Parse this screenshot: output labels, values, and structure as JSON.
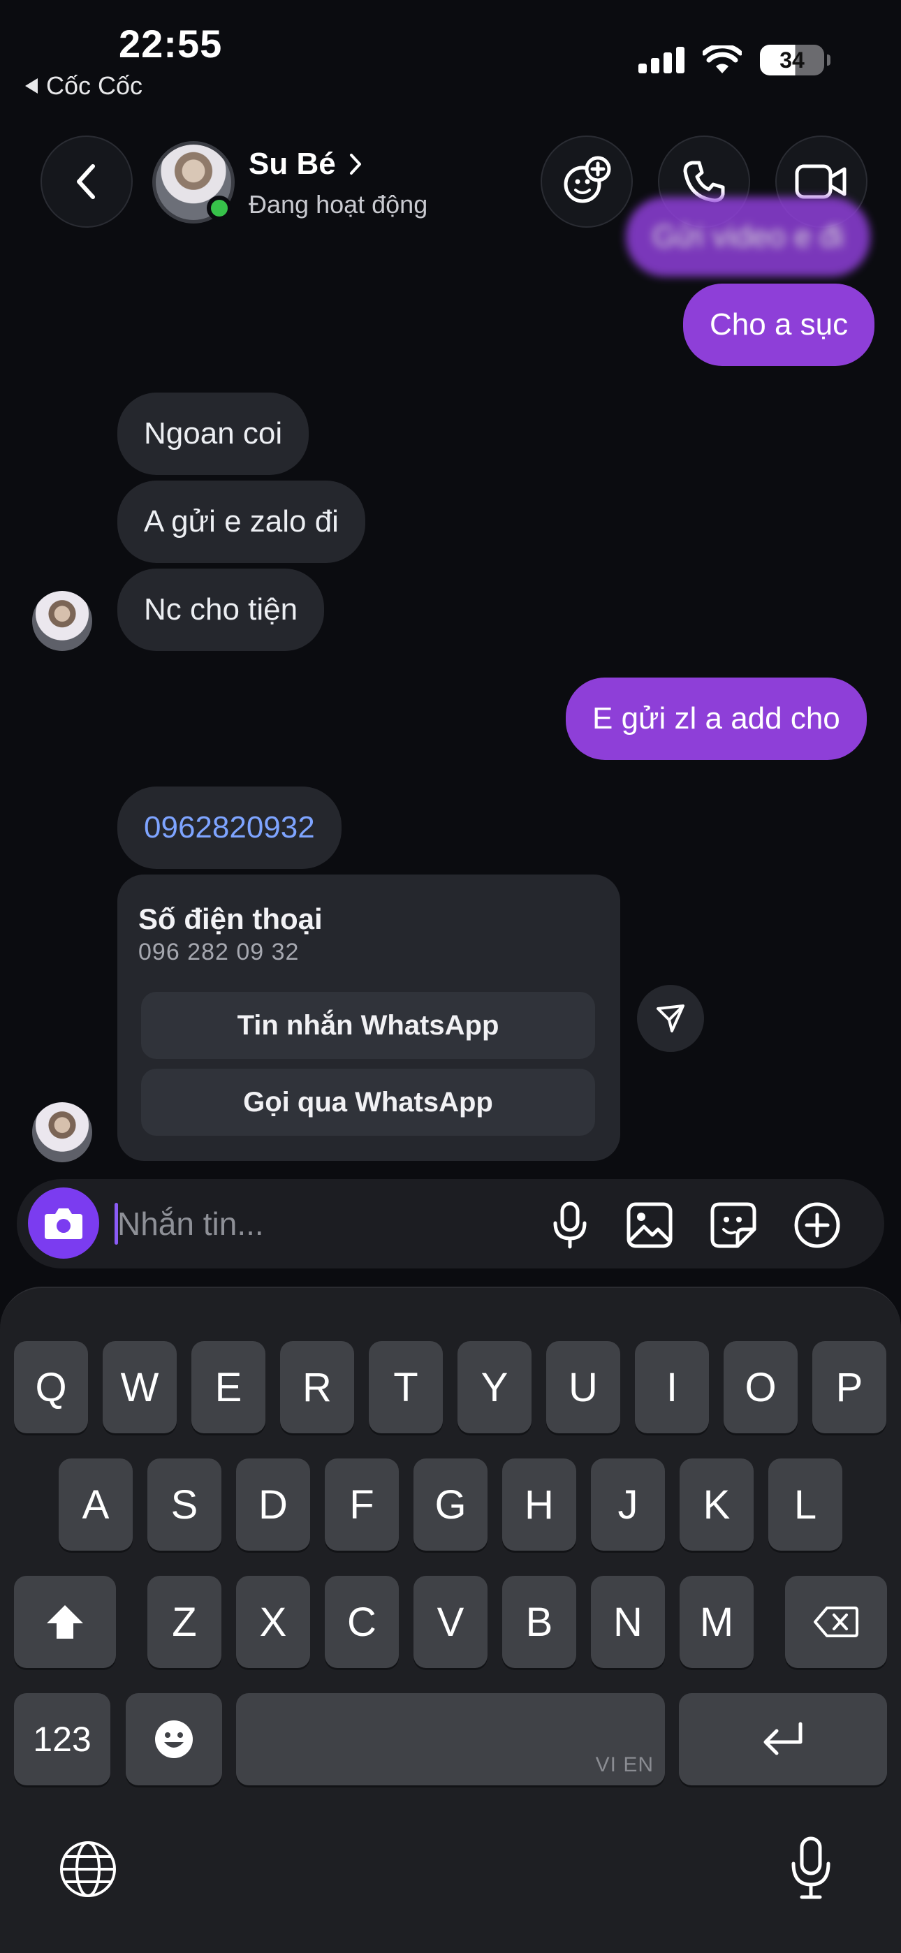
{
  "status_bar": {
    "time": "22:55",
    "back_app": "Cốc Cốc",
    "battery": "34"
  },
  "header": {
    "contact_name": "Su Bé",
    "contact_status": "Đang hoạt động"
  },
  "messages": [
    {
      "side": "out",
      "text": "Gửi video e đi"
    },
    {
      "side": "out",
      "text": "Cho a sục"
    },
    {
      "side": "in",
      "text": "Ngoan coi"
    },
    {
      "side": "in",
      "text": "A gửi e zalo đi"
    },
    {
      "side": "in",
      "text": "Nc cho tiện"
    },
    {
      "side": "out",
      "text": "E gửi zl a add cho"
    },
    {
      "side": "in",
      "text": "0962820932"
    }
  ],
  "phone_card": {
    "title": "Số điện thoại",
    "number": "096 282 09 32",
    "button_message": "Tin nhắn WhatsApp",
    "button_call": "Gọi qua WhatsApp"
  },
  "composer": {
    "placeholder": "Nhắn tin..."
  },
  "keyboard": {
    "row1": [
      "Q",
      "W",
      "E",
      "R",
      "T",
      "Y",
      "U",
      "I",
      "O",
      "P"
    ],
    "row2": [
      "A",
      "S",
      "D",
      "F",
      "G",
      "H",
      "J",
      "K",
      "L"
    ],
    "row3": [
      "Z",
      "X",
      "C",
      "V",
      "B",
      "N",
      "M"
    ],
    "numbers_key": "123",
    "space_lang": "VI EN"
  },
  "colors": {
    "outgoing": "#8e3fd8",
    "incoming": "#25272d",
    "link": "#7ea4ff",
    "accent": "#7b3cf0"
  }
}
